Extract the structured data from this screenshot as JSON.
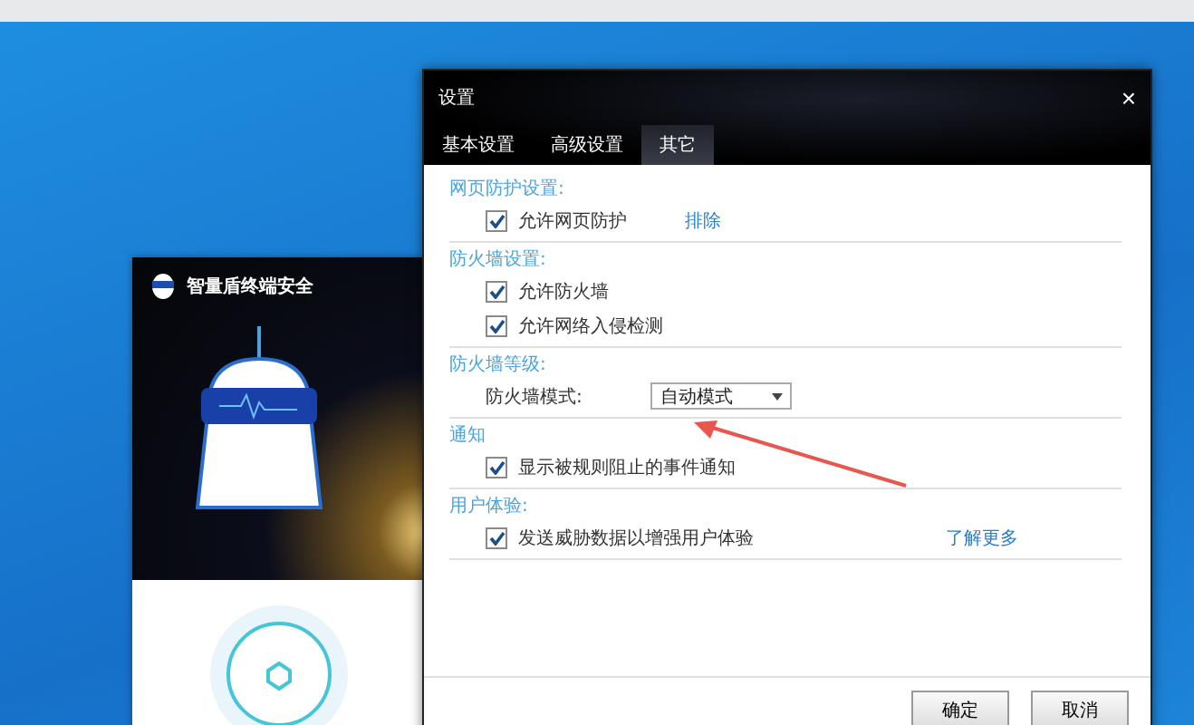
{
  "back_window": {
    "title": "智量盾终端安全"
  },
  "settings": {
    "title": "设置",
    "close": "×",
    "tabs": [
      {
        "label": "基本设置",
        "selected": false
      },
      {
        "label": "高级设置",
        "selected": false
      },
      {
        "label": "其它",
        "selected": true
      }
    ],
    "sections": [
      {
        "heading": "网页防护设置:",
        "items": [
          {
            "kind": "checkbox",
            "label": "允许网页防护",
            "checked": true,
            "link": "排除"
          }
        ]
      },
      {
        "heading": "防火墙设置:",
        "items": [
          {
            "kind": "checkbox",
            "label": "允许防火墙",
            "checked": true
          },
          {
            "kind": "checkbox",
            "label": "允许网络入侵检测",
            "checked": true
          }
        ]
      },
      {
        "heading": "防火墙等级:",
        "items": [
          {
            "kind": "select",
            "label": "防火墙模式:",
            "value": "自动模式"
          }
        ]
      },
      {
        "heading": "通知",
        "items": [
          {
            "kind": "checkbox",
            "label": "显示被规则阻止的事件通知",
            "checked": true
          }
        ]
      },
      {
        "heading": "用户体验:",
        "items": [
          {
            "kind": "checkbox",
            "label": "发送威胁数据以增强用户体验",
            "checked": true,
            "link": "了解更多"
          }
        ]
      }
    ],
    "buttons": [
      "确定",
      "取消"
    ]
  }
}
